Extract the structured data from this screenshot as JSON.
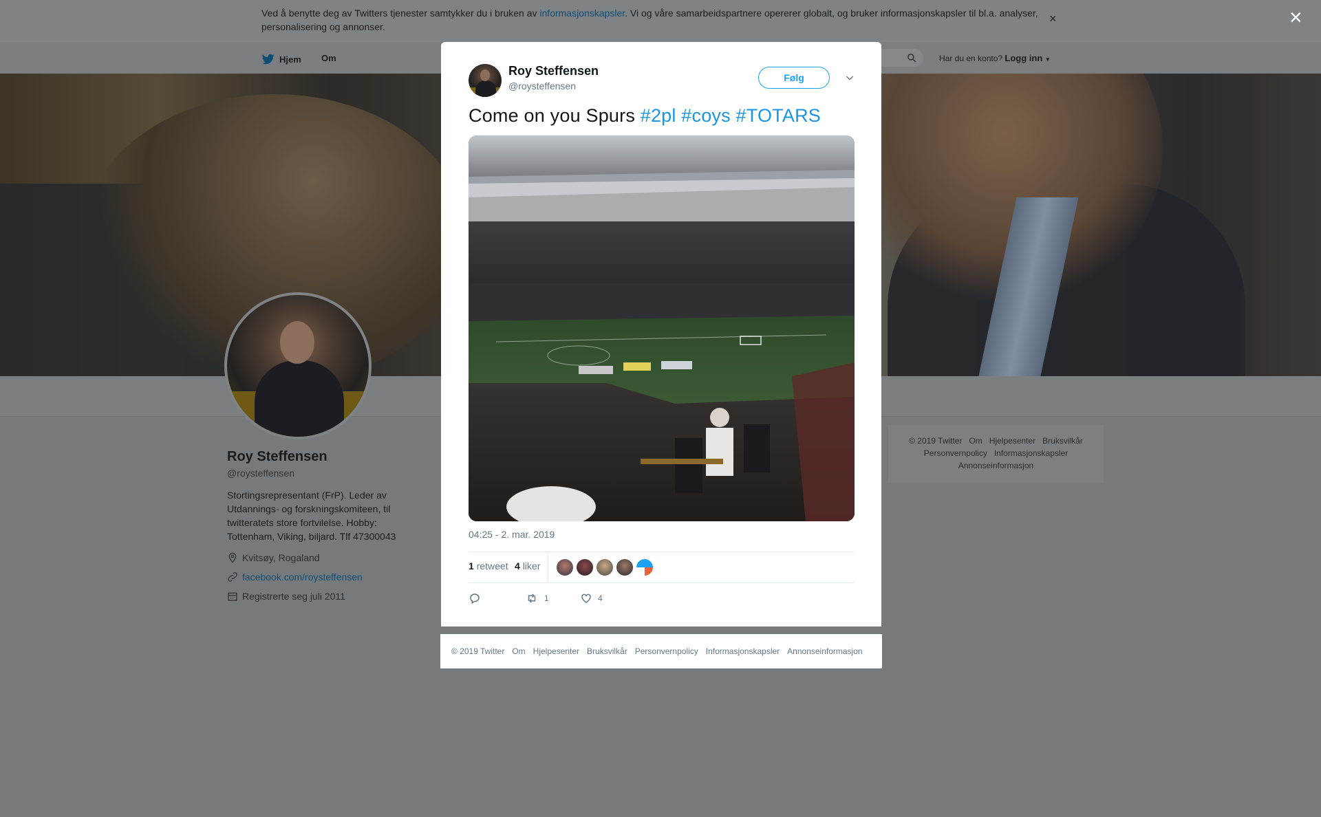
{
  "cookie": {
    "text_before": "Ved å benytte deg av Twitters tjenester samtykker du i bruken av ",
    "link": "informasjonskapsler",
    "text_after": ". Vi og våre samarbeidspartnere opererer globalt, og bruker informasjonskapsler til bl.a. analyser, personalisering og annonser.",
    "close": "×"
  },
  "nav": {
    "home": "Hjem",
    "about": "Om",
    "login_prompt": "Har du en konto?",
    "login": "Logg inn"
  },
  "profile": {
    "name": "Roy Steffensen",
    "handle": "@roysteffensen",
    "bio": "Stortingsrepresentant (FrP). Leder av Utdannings- og forskningskomiteen, til twitteratets store fortvilelse. Hobby: Tottenham, Viking, biljard. Tlf 47300043",
    "location": "Kvitsøy, Rogaland",
    "website": "facebook.com/roysteffensen",
    "joined": "Registrerte seg juli 2011"
  },
  "side_footer": {
    "items": [
      "© 2019 Twitter",
      "Om",
      "Hjelpesenter",
      "Bruksvilkår",
      "Personvernpolicy",
      "Informasjonskapsler",
      "Annonseinformasjon"
    ]
  },
  "overlay_close": "×",
  "tweet": {
    "name": "Roy Steffensen",
    "handle": "@roysteffensen",
    "follow": "Følg",
    "text": "Come on you Spurs ",
    "hashtags": [
      "#2pl",
      "#coys",
      "#TOTARS"
    ],
    "timestamp": "04:25 - 2. mar. 2019",
    "retweets_count": "1",
    "retweets_label": "retweet",
    "likes_count": "4",
    "likes_label": "liker",
    "actions": {
      "reply": "",
      "retweet": "1",
      "like": "4"
    }
  },
  "modal_footer": {
    "items": [
      "© 2019 Twitter",
      "Om",
      "Hjelpesenter",
      "Bruksvilkår",
      "Personvernpolicy",
      "Informasjonskapsler",
      "Annonseinformasjon"
    ]
  },
  "colors": {
    "accent": "#1da1f2",
    "hashtag": "#1b95e0",
    "muted": "#657786"
  }
}
